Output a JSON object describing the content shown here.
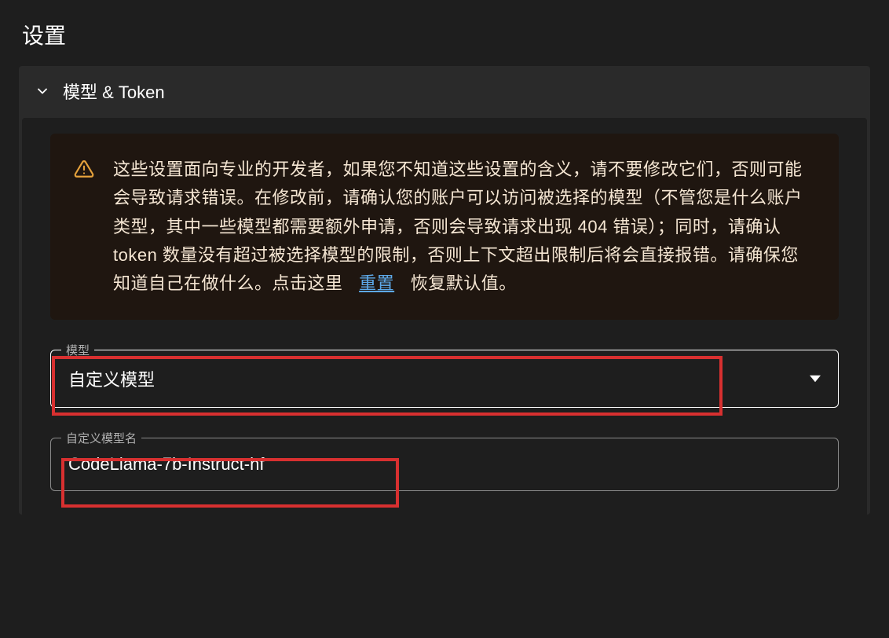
{
  "page": {
    "title": "设置"
  },
  "accordion": {
    "title": "模型 & Token"
  },
  "alert": {
    "text_before_link": "这些设置面向专业的开发者，如果您不知道这些设置的含义，请不要修改它们，否则可能会导致请求错误。在修改前，请确认您的账户可以访问被选择的模型（不管您是什么账户类型，其中一些模型都需要额外申请，否则会导致请求出现 404 错误）；同时，请确认 token 数量没有超过被选择模型的限制，否则上下文超出限制后将会直接报错。请确保您知道自己在做什么。点击这里",
    "reset_link": "重置",
    "text_after_link": "恢复默认值。"
  },
  "model_field": {
    "label": "模型",
    "value": "自定义模型"
  },
  "custom_model_field": {
    "label": "自定义模型名",
    "value": "CodeLlama-7b-Instruct-hf"
  }
}
